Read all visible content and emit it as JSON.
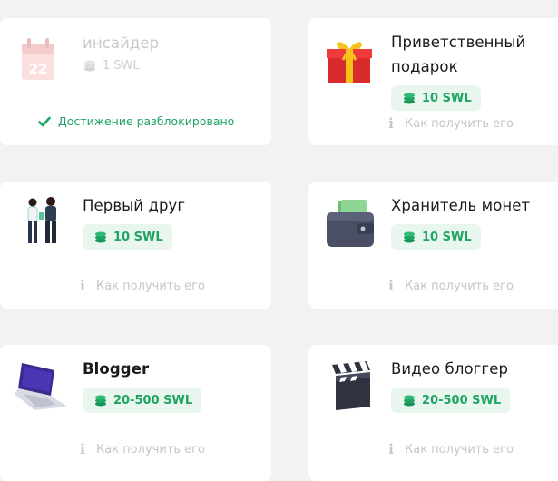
{
  "cards": [
    {
      "title": "инсайдер",
      "reward": "1 SWL",
      "status_text": "Достижение разблокировано",
      "illustration": "calendar-icon"
    },
    {
      "title_line1": "Приветственный",
      "title_line2": "подарок",
      "reward": "10 SWL",
      "how_label": "Как получить его",
      "illustration": "gift-box-icon"
    },
    {
      "title": "Первый друг",
      "reward": "10 SWL",
      "how_label": "Как получить его",
      "illustration": "two-people-icon"
    },
    {
      "title": "Хранитель монет",
      "reward": "10 SWL",
      "how_label": "Как получить его",
      "illustration": "wallet-icon"
    },
    {
      "title": "Blogger",
      "reward": "20-500 SWL",
      "how_label": "Как получить его",
      "illustration": "laptop-icon"
    },
    {
      "title": "Видео блоггер",
      "reward": "20-500 SWL",
      "how_label": "Как получить его",
      "illustration": "clapperboard-icon"
    }
  ],
  "colors": {
    "accent_green": "#1fa464",
    "pill_background": "#e8f6ee",
    "muted_text": "#c6c6ca",
    "page_background": "#f2f2f3"
  }
}
